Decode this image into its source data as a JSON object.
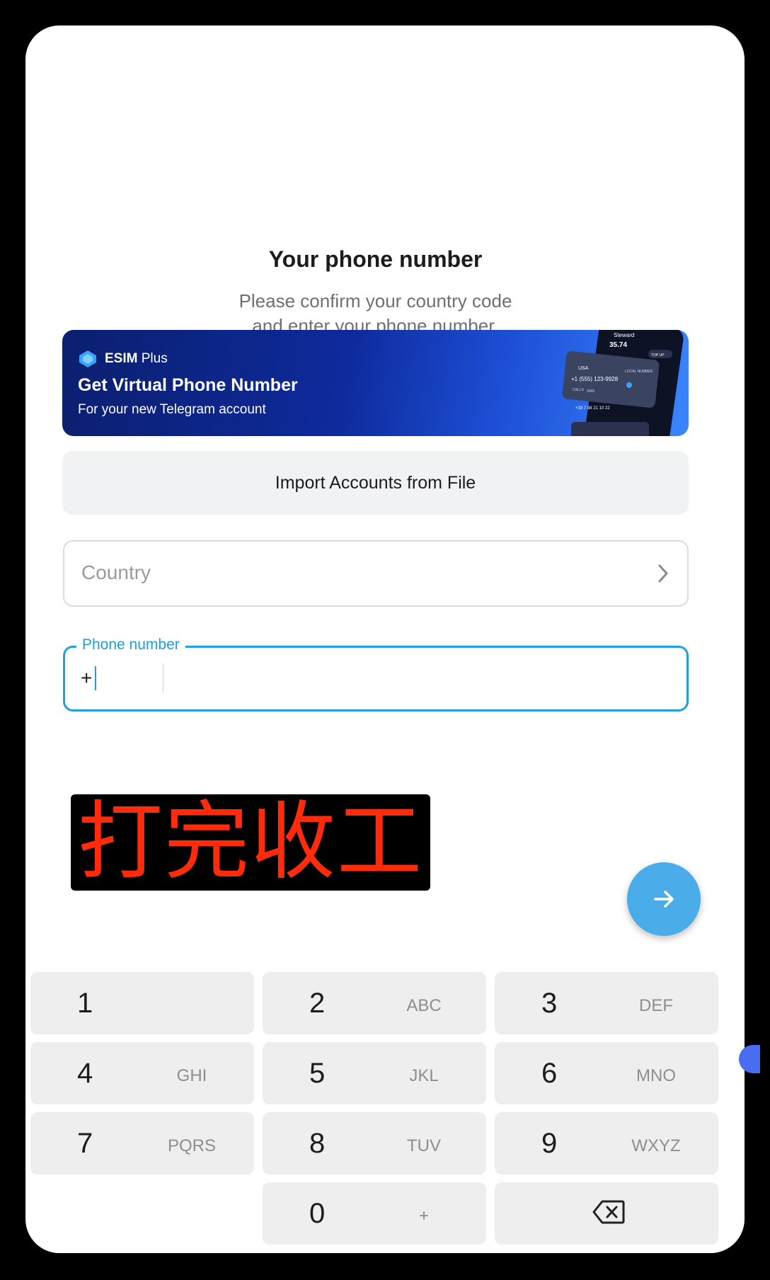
{
  "header": {
    "title": "Your phone number",
    "subtitle_line1": "Please confirm your country code",
    "subtitle_line2": "and enter your phone number."
  },
  "banner": {
    "brand_bold": "ESIM",
    "brand_light": " Plus",
    "title": "Get Virtual Phone Number",
    "subtitle": "For your new Telegram account",
    "phone_art": {
      "balance": "35.74",
      "name": "Steward",
      "top_up": "TOP UP",
      "country": "USA",
      "local_number": "LOCAL NUMBER",
      "number": "+1 (555) 123-9928",
      "tags": [
        "CALLS",
        "SMS"
      ],
      "number2": "+33 7 88 21 10 22"
    },
    "colors": {
      "start": "#0b1f6e",
      "end": "#3a86ff"
    }
  },
  "import_button": {
    "label": "Import Accounts from File"
  },
  "country_field": {
    "placeholder": "Country",
    "icon": "chevron-right-icon"
  },
  "phone_field": {
    "label": "Phone number",
    "prefix": "+",
    "accent": "#1fa0e0"
  },
  "overlay_stamp": {
    "text": "打完收工",
    "color": "#ff2b0b"
  },
  "fab": {
    "icon": "arrow-right-icon",
    "color": "#4aace8"
  },
  "keypad": {
    "keys": [
      {
        "num": "1",
        "letters": ""
      },
      {
        "num": "2",
        "letters": "ABC"
      },
      {
        "num": "3",
        "letters": "DEF"
      },
      {
        "num": "4",
        "letters": "GHI"
      },
      {
        "num": "5",
        "letters": "JKL"
      },
      {
        "num": "6",
        "letters": "MNO"
      },
      {
        "num": "7",
        "letters": "PQRS"
      },
      {
        "num": "8",
        "letters": "TUV"
      },
      {
        "num": "9",
        "letters": "WXYZ"
      },
      {
        "num": "0",
        "letters": "+"
      }
    ],
    "backspace_icon": "backspace-icon"
  }
}
